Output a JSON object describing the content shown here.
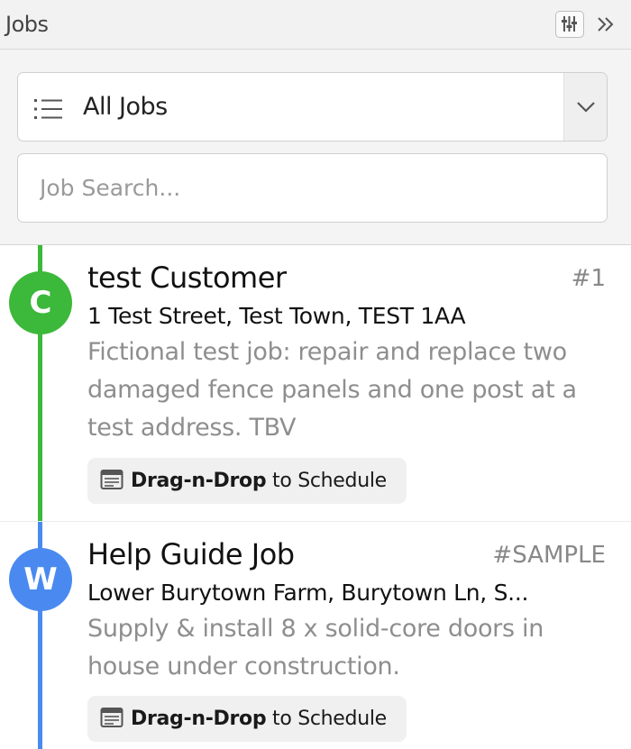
{
  "header": {
    "title": "Jobs",
    "filter_icon": "filter-sliders-icon",
    "collapse_icon": "double-chevron-right-icon"
  },
  "filter": {
    "selected": "All Jobs",
    "icon": "list-icon"
  },
  "search": {
    "placeholder": "Job Search..."
  },
  "jobs": [
    {
      "avatar": "C",
      "color": "#3cb83a",
      "customer": "test Customer",
      "number": "#1",
      "address": "1 Test Street, Test Town, TEST 1AA",
      "description": "Fictional test job: repair and replace two damaged fence panels and one post at a test address. TBV",
      "action_bold": "Drag-n-Drop",
      "action_rest": "to Schedule"
    },
    {
      "avatar": "W",
      "color": "#4a8af0",
      "customer": "Help Guide Job",
      "number": "#SAMPLE",
      "address": "Lower Burytown Farm, Burytown Ln, S...",
      "description": "Supply & install 8 x solid-core doors in house under construction.",
      "action_bold": "Drag-n-Drop",
      "action_rest": "to Schedule"
    }
  ]
}
